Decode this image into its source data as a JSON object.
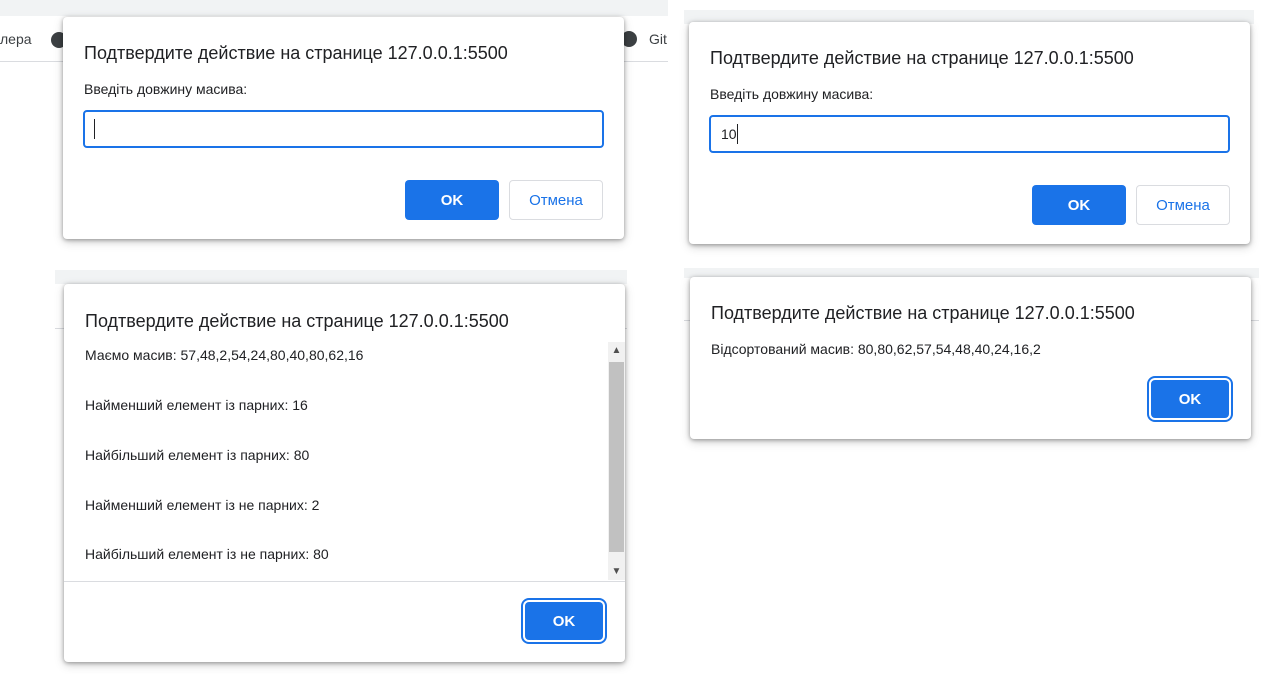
{
  "background": {
    "tab_fragment_left": "лера",
    "tab_fragment_right": "Git"
  },
  "dialog1": {
    "title": "Подтвердите действие на странице 127.0.0.1:5500",
    "message": "Введіть довжину масива:",
    "input_value": "",
    "ok_label": "OK",
    "cancel_label": "Отмена"
  },
  "dialog2": {
    "title": "Подтвердите действие на странице 127.0.0.1:5500",
    "message": "Введіть довжину масива:",
    "input_value": "10",
    "ok_label": "OK",
    "cancel_label": "Отмена"
  },
  "dialog3": {
    "title": "Подтвердите действие на странице 127.0.0.1:5500",
    "lines": [
      "Маємо масив: 57,48,2,54,24,80,40,80,62,16",
      "Найменший елемент із парних: 16",
      "Найбільший елемент із парних: 80",
      "Найменший елемент із не парних: 2",
      "Найбільший елемент із не парних: 80"
    ],
    "ok_label": "OK"
  },
  "dialog4": {
    "title": "Подтвердите действие на странице 127.0.0.1:5500",
    "message": "Відсортований масив: 80,80,62,57,54,48,40,24,16,2",
    "ok_label": "OK"
  },
  "colors": {
    "accent": "#1a73e8",
    "dialog_bg": "#ffffff",
    "browser_strip": "#f1f3f4"
  }
}
